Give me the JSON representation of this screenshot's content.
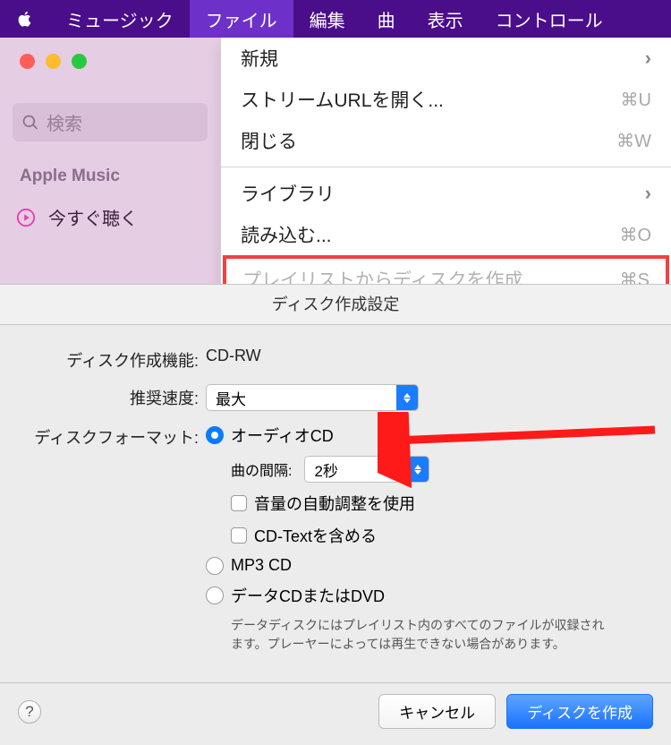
{
  "menubar": {
    "app": "ミュージック",
    "items": [
      "ファイル",
      "編集",
      "曲",
      "表示",
      "コントロール"
    ],
    "active_index": 0
  },
  "sidebar": {
    "search_placeholder": "検索",
    "section": "Apple Music",
    "nav0": "今すぐ聴く"
  },
  "dropdown": {
    "items": [
      {
        "label": "新規",
        "sub": true
      },
      {
        "label": "ストリームURLを開く...",
        "sc": "⌘U"
      },
      {
        "label": "閉じる",
        "sc": "⌘W"
      },
      "sep",
      {
        "label": "ライブラリ",
        "sub": true
      },
      {
        "label": "読み込む...",
        "sc": "⌘O"
      },
      {
        "label": "プレイリストからディスクを作成...",
        "sc": "⌘S",
        "disabled": true,
        "boxed": true
      }
    ]
  },
  "sheet": {
    "title": "ディスク作成設定",
    "device_label": "ディスク作成機能:",
    "device_value": "CD-RW",
    "speed_label": "推奨速度:",
    "speed_value": "最大",
    "format_label": "ディスクフォーマット:",
    "opt_audio": "オーディオCD",
    "gap_label": "曲の間隔:",
    "gap_value": "2秒",
    "chk_sound": "音量の自動調整を使用",
    "chk_cdtext": "CD-Textを含める",
    "opt_mp3": "MP3 CD",
    "opt_data": "データCDまたはDVD",
    "data_hint": "データディスクにはプレイリスト内のすべてのファイルが収録されます。プレーヤーによっては再生できない場合があります。",
    "btn_cancel": "キャンセル",
    "btn_create": "ディスクを作成"
  }
}
